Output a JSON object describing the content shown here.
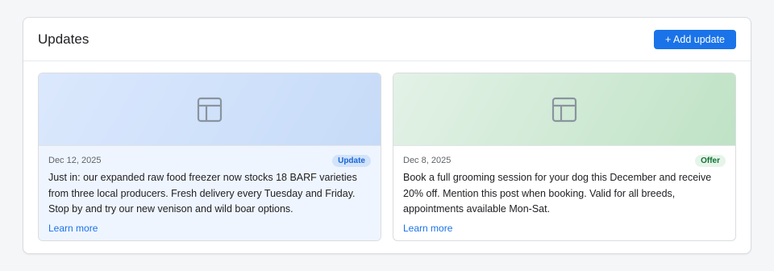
{
  "header": {
    "title": "Updates",
    "add_button_label": "+ Add update"
  },
  "posts": [
    {
      "date": "Dec 12, 2025",
      "badge": "Update",
      "text": "Just in: our expanded raw food freezer now stocks 18 BARF varieties from three local producers. Fresh delivery every Tuesday and Friday. Stop by and try our new venison and wild boar options.",
      "link_label": "Learn more",
      "image_icon": "layout-placeholder-icon"
    },
    {
      "date": "Dec 8, 2025",
      "badge": "Offer",
      "text": "Book a full grooming session for your dog this December and receive 20% off. Mention this post when booking. Valid for all breeds, appointments available Mon-Sat.",
      "link_label": "Learn more",
      "image_icon": "layout-placeholder-icon"
    }
  ],
  "colors": {
    "accent": "#1a73e8",
    "update_badge_bg": "#d2e3fc",
    "offer_badge_bg": "#e6f4ea",
    "offer_badge_text": "#137333"
  }
}
